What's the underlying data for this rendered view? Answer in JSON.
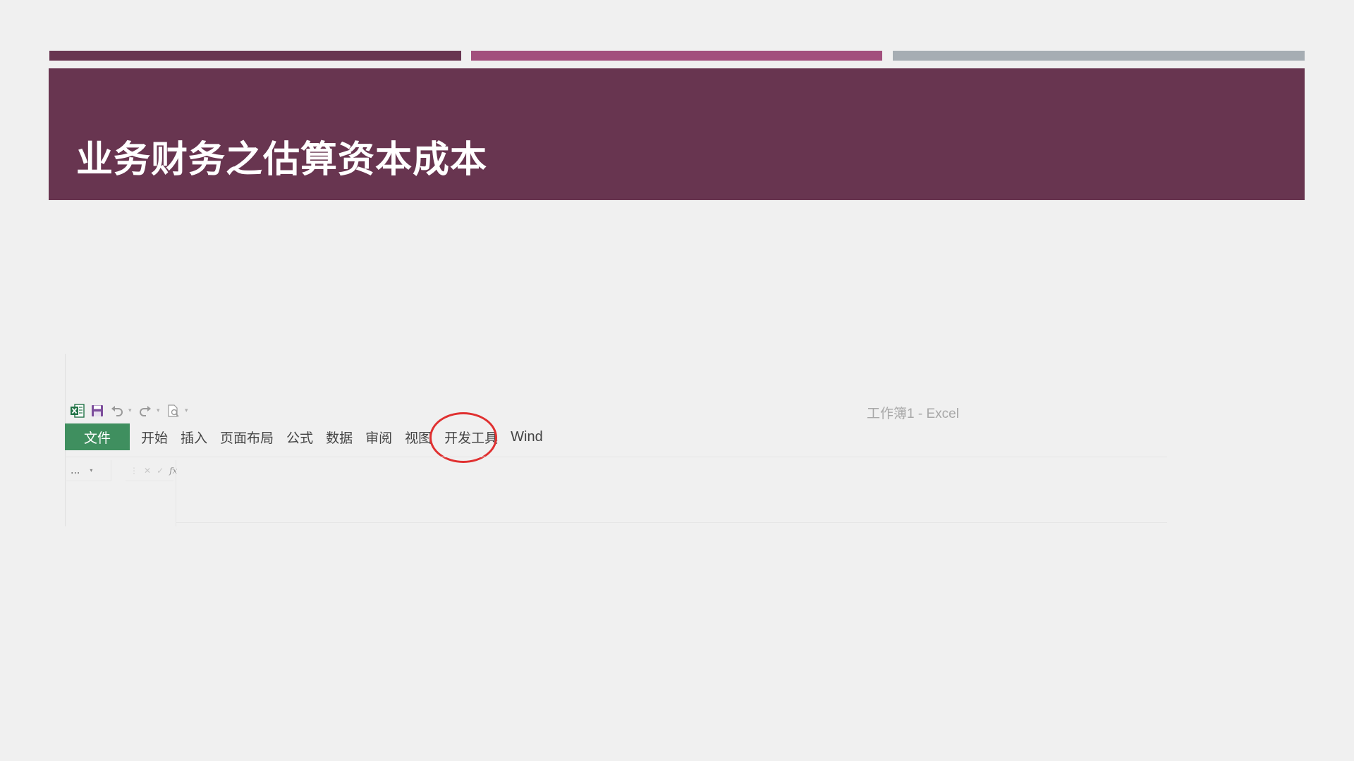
{
  "slide": {
    "title": "业务财务之估算资本成本",
    "colors": {
      "banner": "#683550",
      "stripe_mid": "#a24f7d",
      "stripe_right": "#a6adb3"
    }
  },
  "excel": {
    "window_title": "工作簿1 - Excel",
    "quick_access": [
      "excel-logo-icon",
      "save-icon",
      "undo-icon",
      "redo-icon",
      "print-preview-icon"
    ],
    "tabs": {
      "file": "文件",
      "home": "开始",
      "insert": "插入",
      "page_layout": "页面布局",
      "formulas": "公式",
      "data": "数据",
      "review": "审阅",
      "view": "视图",
      "developer": "开发工具",
      "wind": "Wind"
    },
    "highlighted_tab": "开发工具",
    "highlight_color": "#e03030",
    "file_tab_color": "#3f8f5f",
    "name_box": "...",
    "formula_buttons": {
      "cancel": "✕",
      "enter": "✓",
      "function": "fx"
    }
  }
}
